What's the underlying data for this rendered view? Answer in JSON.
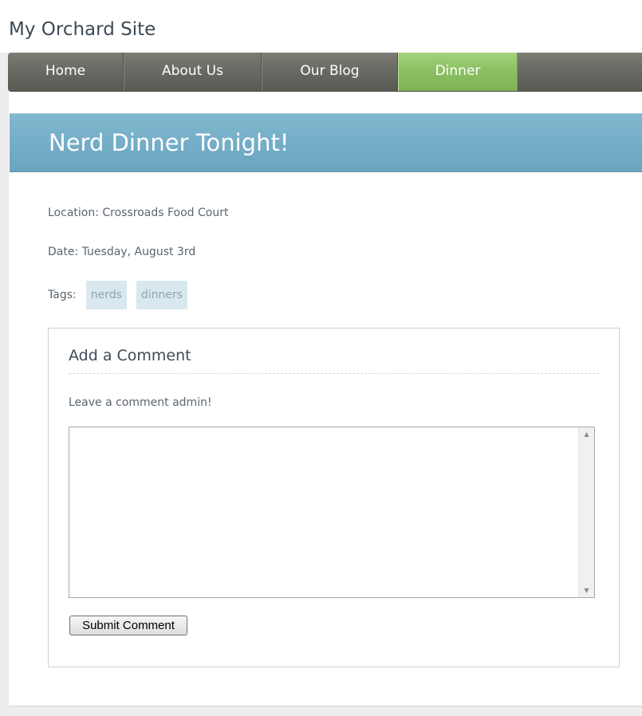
{
  "site": {
    "title": "My Orchard Site"
  },
  "nav": {
    "items": [
      {
        "label": "Home",
        "active": false
      },
      {
        "label": "About Us",
        "active": false
      },
      {
        "label": "Our Blog",
        "active": false
      },
      {
        "label": "Dinner",
        "active": true
      }
    ]
  },
  "page": {
    "title": "Nerd Dinner Tonight!",
    "location": "Location: Crossroads Food Court",
    "date": "Date: Tuesday, August 3rd",
    "tags_label": "Tags:",
    "tags": [
      "nerds",
      "dinners"
    ]
  },
  "comments": {
    "heading": "Add a Comment",
    "prompt": "Leave a comment admin!",
    "textarea_value": "",
    "submit_label": "Submit Comment"
  },
  "colors": {
    "nav_bg": "#6a6a64",
    "nav_active": "#8cc062",
    "hero_bg": "#74aec7",
    "tag_bg": "#d9e8ef",
    "tag_text": "#8ea5b3"
  },
  "icons": {
    "scroll_up": "scroll-up-arrow-icon",
    "scroll_down": "scroll-down-arrow-icon"
  }
}
